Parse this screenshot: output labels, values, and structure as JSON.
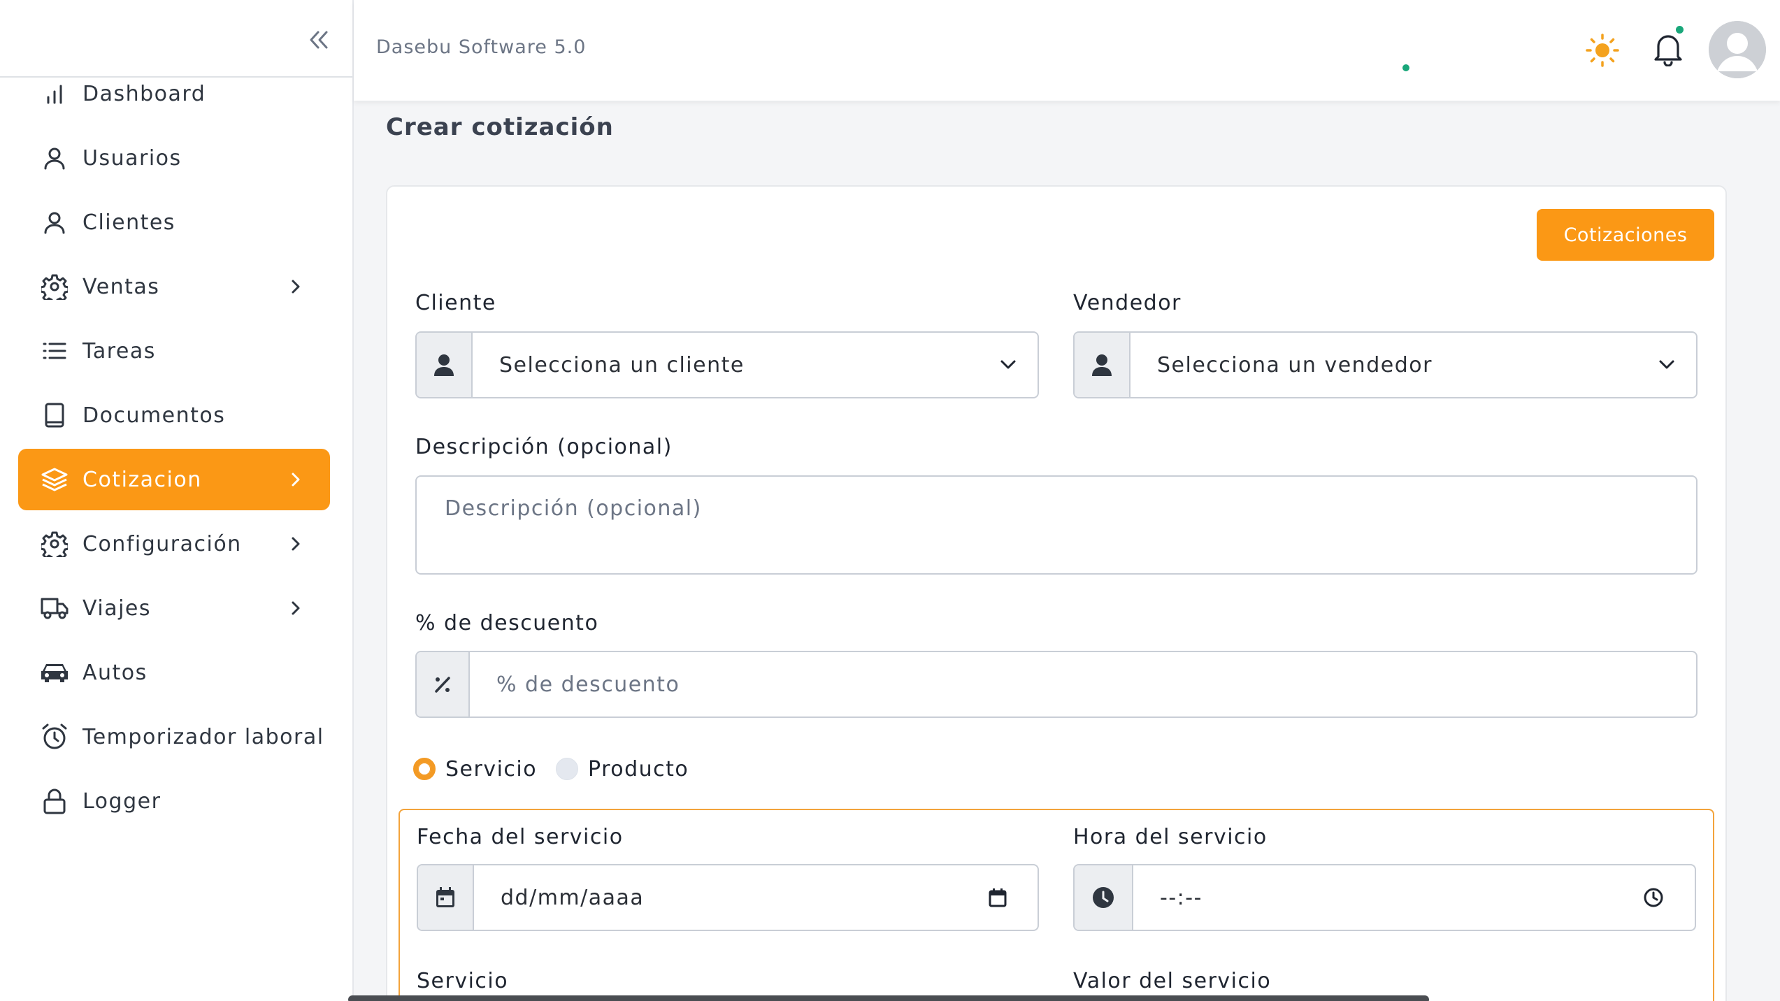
{
  "app": {
    "title": "Dasebu Software 5.0"
  },
  "colors": {
    "accent": "#fb9815",
    "status_online": "#19a77a"
  },
  "sidebar": {
    "items": [
      {
        "label": "Dashboard",
        "icon": "bar-chart-icon",
        "has_submenu": false,
        "active": false
      },
      {
        "label": "Usuarios",
        "icon": "user-icon",
        "has_submenu": false,
        "active": false
      },
      {
        "label": "Clientes",
        "icon": "user-icon",
        "has_submenu": false,
        "active": false
      },
      {
        "label": "Ventas",
        "icon": "gear-icon",
        "has_submenu": true,
        "active": false
      },
      {
        "label": "Tareas",
        "icon": "list-icon",
        "has_submenu": false,
        "active": false
      },
      {
        "label": "Documentos",
        "icon": "book-icon",
        "has_submenu": false,
        "active": false
      },
      {
        "label": "Cotizacion",
        "icon": "layers-icon",
        "has_submenu": true,
        "active": true
      },
      {
        "label": "Configuración",
        "icon": "gear-icon",
        "has_submenu": true,
        "active": false
      },
      {
        "label": "Viajes",
        "icon": "truck-icon",
        "has_submenu": true,
        "active": false
      },
      {
        "label": "Autos",
        "icon": "car-icon",
        "has_submenu": false,
        "active": false
      },
      {
        "label": "Temporizador laboral",
        "icon": "alarm-clock-icon",
        "has_submenu": false,
        "active": false
      },
      {
        "label": "Logger",
        "icon": "lock-icon",
        "has_submenu": false,
        "active": false
      }
    ]
  },
  "page": {
    "title": "Crear cotización",
    "cotizaciones_button": "Cotizaciones"
  },
  "form": {
    "cliente": {
      "label": "Cliente",
      "value": "Selecciona un cliente"
    },
    "vendedor": {
      "label": "Vendedor",
      "value": "Selecciona un vendedor"
    },
    "descripcion": {
      "label": "Descripción (opcional)",
      "placeholder": "Descripción (opcional)"
    },
    "descuento": {
      "label": "% de descuento",
      "placeholder": "% de descuento"
    },
    "tipo": {
      "options": [
        {
          "label": "Servicio",
          "checked": true
        },
        {
          "label": "Producto",
          "checked": false
        }
      ]
    },
    "fecha_servicio": {
      "label": "Fecha del servicio",
      "placeholder": "dd/mm/aaaa"
    },
    "hora_servicio": {
      "label": "Hora del servicio",
      "placeholder": "--:--"
    },
    "servicio": {
      "label": "Servicio"
    },
    "valor_servicio": {
      "label": "Valor del servicio"
    }
  }
}
